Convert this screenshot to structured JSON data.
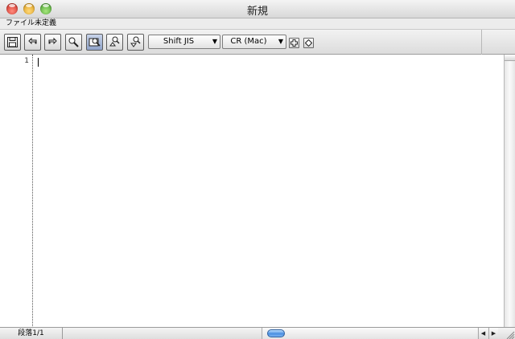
{
  "window": {
    "title": "新規",
    "file_status": "ファイル未定義"
  },
  "toolbar": {
    "buttons": [
      "save-icon",
      "undo-icon",
      "redo-icon",
      "find-icon",
      "find-selected-icon",
      "find-previous-icon",
      "find-next-icon"
    ],
    "encoding": "Shift JIS",
    "line_ending": "CR (Mac)"
  },
  "editor": {
    "line_number": "1",
    "content": ""
  },
  "status": {
    "paragraph": "段落1/1"
  },
  "colors": {
    "close": "#d8382d",
    "minimize": "#e8a523",
    "zoom": "#57b13a",
    "scroll_thumb": "#4a8ee0"
  }
}
